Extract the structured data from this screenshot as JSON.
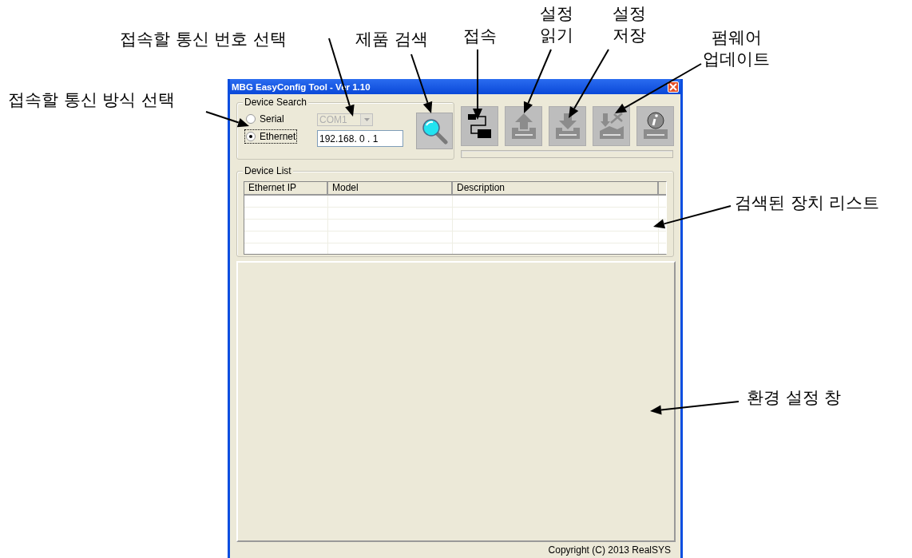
{
  "window": {
    "title": "MBG EasyConfig Tool - Ver 1.10"
  },
  "device_search": {
    "label": "Device Search",
    "radios": [
      {
        "label": "Serial",
        "selected": false
      },
      {
        "label": "Ethernet",
        "selected": true
      }
    ],
    "com_port": {
      "value": "COM1",
      "disabled": true
    },
    "ip_field": {
      "value": "192.168. 0 . 1"
    }
  },
  "toolbar": [
    {
      "kind": "connect",
      "disabled": false
    },
    {
      "kind": "read",
      "disabled": true
    },
    {
      "kind": "save",
      "disabled": true
    },
    {
      "kind": "firmware",
      "disabled": true
    },
    {
      "kind": "info",
      "disabled": true
    }
  ],
  "progress": {
    "level": 0
  },
  "device_list": {
    "label": "Device  List",
    "columns": [
      "Ethernet IP",
      "Model",
      "Description"
    ]
  },
  "status_bar": {
    "text": "Copyright (C) 2013 RealSYS"
  },
  "annotations": [
    "접속할 통신 방식 선택",
    "접속할 통신 번호 선택",
    "제품 검색",
    "접속",
    "설정\n읽기",
    "설정\n저장",
    "펌웨어\n업데이트",
    "검색된 장치 리스트",
    "환경 설정 창"
  ]
}
